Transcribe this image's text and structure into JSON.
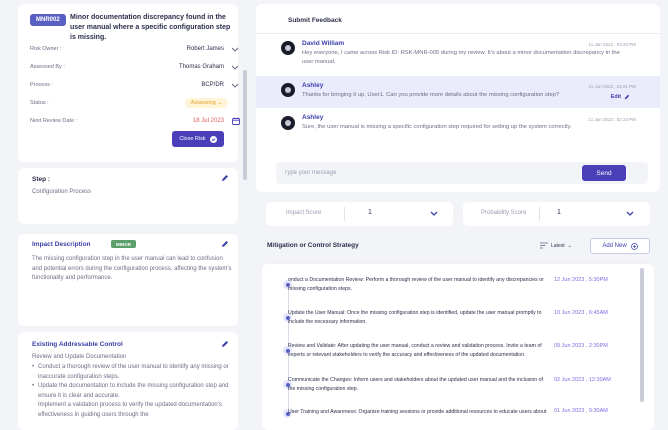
{
  "risk": {
    "id": "MNR002",
    "title": "Minor documentation discrepancy found in the user manual where a specific configuration step is missing.",
    "fields": [
      {
        "label": "Risk Owner :",
        "value": "Robert James"
      },
      {
        "label": "Assessed By :",
        "value": "Thomas Graham"
      },
      {
        "label": "Process :",
        "value": "BCP/DR"
      },
      {
        "label": "Status :",
        "value": "Assessing"
      },
      {
        "label": "Next Review Date :",
        "value": "18 Jul 2023"
      }
    ],
    "close_label": "Close Risk"
  },
  "step": {
    "title": "Step :",
    "value": "Configuration Process"
  },
  "impact": {
    "title": "Impact Description",
    "badge": "MINOR",
    "text": "The missing configuration step in the user manual can lead to confusion and potential errors during the configuration process, affecting the system's functionality and performance."
  },
  "control": {
    "title": "Existing Addressable Control",
    "intro": "Review and Update Documentation",
    "bullets": [
      "Conduct a thorough review of the user manual to identify any missing or inaccurate configuration steps.",
      "Update the documentation to include the missing configuration step and ensure it is clear and accurate.",
      "Implement a validation process to verify the updated documentation's effectiveness in guiding users through the"
    ]
  },
  "feedback": {
    "title": "Submit Feedback",
    "messages": [
      {
        "name": "David William",
        "time": "11 Jan 2023 , 03:20 PM",
        "text": "Hey everyone, I came across Risk ID: RSK-MNR-005 during my review. It's about a minor documentation discrepancy in the user manual.",
        "edit": ""
      },
      {
        "name": "Ashley",
        "time": "11 Jun 2023 , 02:21 PM",
        "text": "Thanks for bringing it up, User1. Can you provide more details about the missing configuration step?",
        "edit": "Edit"
      },
      {
        "name": "Ashley",
        "time": "11 Jan 2023 , 02:23 PM",
        "text": "Sure, the user manual is missing a specific configuration step required for setting up the system correctly.",
        "edit": ""
      }
    ],
    "input_placeholder": "Type your message",
    "send_label": "Send"
  },
  "scores": {
    "impact_label": "Impact Score",
    "impact_value": "1",
    "probability_label": "Probability Score",
    "probability_value": "1"
  },
  "mitigation": {
    "title": "Mitigation or Control Strategy",
    "sort_label": "Latest",
    "add_label": "Add New",
    "items": [
      {
        "text": "onduct a Documentation Review: Perform a thorough review of the user manual to identify any discrepancies or missing configuration steps.",
        "date": "12 Jun 2023 , 5:30PM"
      },
      {
        "text": "Update the User Manual: Once the missing configuration step is identified, update the user manual promptly to include the necessary information.",
        "date": "10 Jun 2023 , 6:45AM"
      },
      {
        "text": "Review and Validate: After updating the user manual, conduct a review and validation process. Invite a team of experts or relevant stakeholders to verify the accuracy and effectiveness of the updated documentation.",
        "date": "09 Jun 2023 , 2:30PM"
      },
      {
        "text": "Communicate the Changes: Inform users and stakeholders about the updated user manual and the inclusion of the missing configuration step.",
        "date": "02 Jun 2023 , 12:30AM"
      },
      {
        "text": "User Training and Awareness: Organize training sessions or provide additional resources to educate users about",
        "date": "01 Jun 2023 , 9:30AM"
      }
    ]
  }
}
